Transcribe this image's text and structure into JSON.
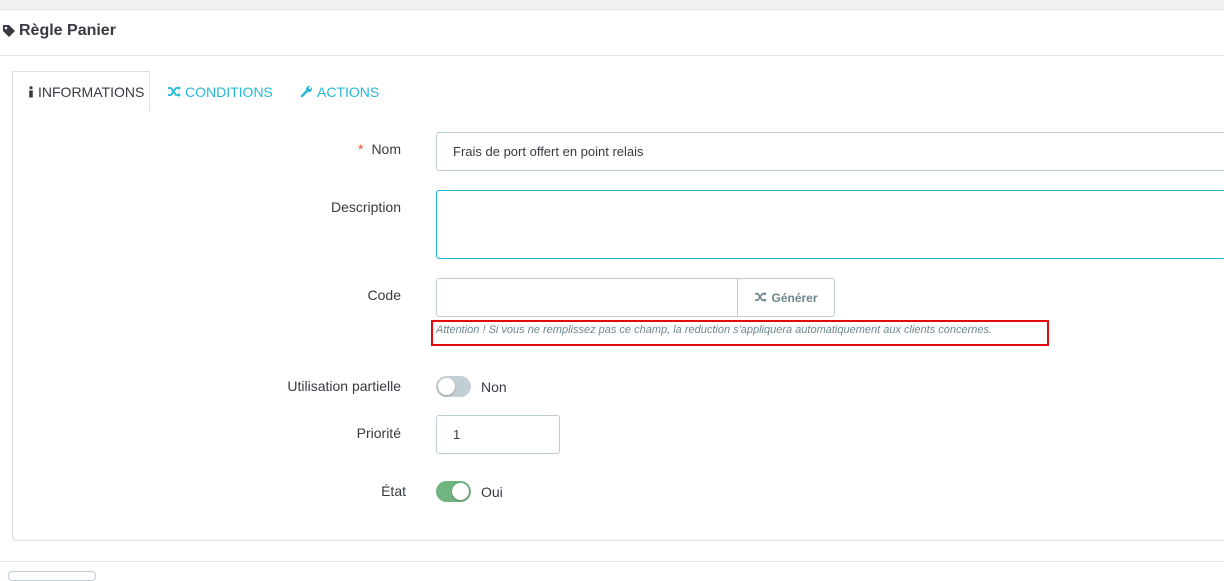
{
  "header": {
    "title": "Règle Panier",
    "icon": "tag-icon"
  },
  "tabs": [
    {
      "label": "INFORMATIONS",
      "icon": "info-icon",
      "active": true
    },
    {
      "label": "CONDITIONS",
      "icon": "random-icon",
      "active": false
    },
    {
      "label": "ACTIONS",
      "icon": "wrench-icon",
      "active": false
    }
  ],
  "form": {
    "nom": {
      "label": "Nom",
      "required_marker": "*",
      "value": "Frais de port offert en point relais"
    },
    "description": {
      "label": "Description",
      "value": ""
    },
    "code": {
      "label": "Code",
      "value": "",
      "generate_label": "Générer",
      "help": "Attention ! Si vous ne remplissez pas ce champ, la reduction s'appliquera automatiquement aux clients concernes."
    },
    "utilisation_partielle": {
      "label": "Utilisation partielle",
      "state_text": "Non",
      "enabled": false
    },
    "priorite": {
      "label": "Priorité",
      "value": "1"
    },
    "etat": {
      "label": "État",
      "state_text": "Oui",
      "enabled": true
    }
  },
  "colors": {
    "accent": "#25b9d7",
    "switch_on": "#70b580",
    "switch_off": "#c3cfd4",
    "warning_border": "#e20a0a",
    "required": "#e84e2c"
  }
}
